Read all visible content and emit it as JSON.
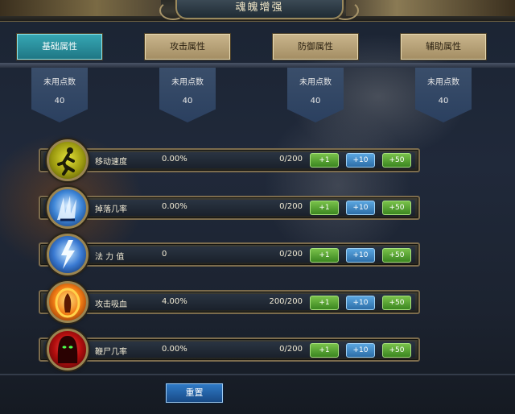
{
  "window": {
    "title": "魂魄增强"
  },
  "tabs": [
    {
      "label": "基础属性",
      "active": true
    },
    {
      "label": "攻击属性",
      "active": false
    },
    {
      "label": "防御属性",
      "active": false
    },
    {
      "label": "辅助属性",
      "active": false
    }
  ],
  "points": [
    {
      "label": "未用点数",
      "value": "40"
    },
    {
      "label": "未用点数",
      "value": "40"
    },
    {
      "label": "未用点数",
      "value": "40"
    },
    {
      "label": "未用点数",
      "value": "40"
    }
  ],
  "attributes": [
    {
      "name": "移动速度",
      "percent": "0.00%",
      "value": "0/200",
      "icon": "running-figure-icon"
    },
    {
      "name": "掉落几率",
      "percent": "0.00%",
      "value": "0/200",
      "icon": "ice-claw-icon"
    },
    {
      "name": "法 力 值",
      "percent": "0",
      "value": "0/200",
      "icon": "lightning-icon"
    },
    {
      "name": "攻击吸血",
      "percent": "4.00%",
      "value": "200/200",
      "icon": "fire-warrior-icon"
    },
    {
      "name": "鞭尸几率",
      "percent": "0.00%",
      "value": "0/200",
      "icon": "hooded-reaper-icon"
    }
  ],
  "buttons": {
    "plus1": "+1",
    "plus10": "+10",
    "plus50": "+50"
  },
  "reset_label": "重置",
  "colors": {
    "active_tab": "#2a8f9c",
    "inactive_tab": "#b8a478",
    "green_button": "#4f9a2c",
    "blue_button": "#3b7fbd"
  }
}
